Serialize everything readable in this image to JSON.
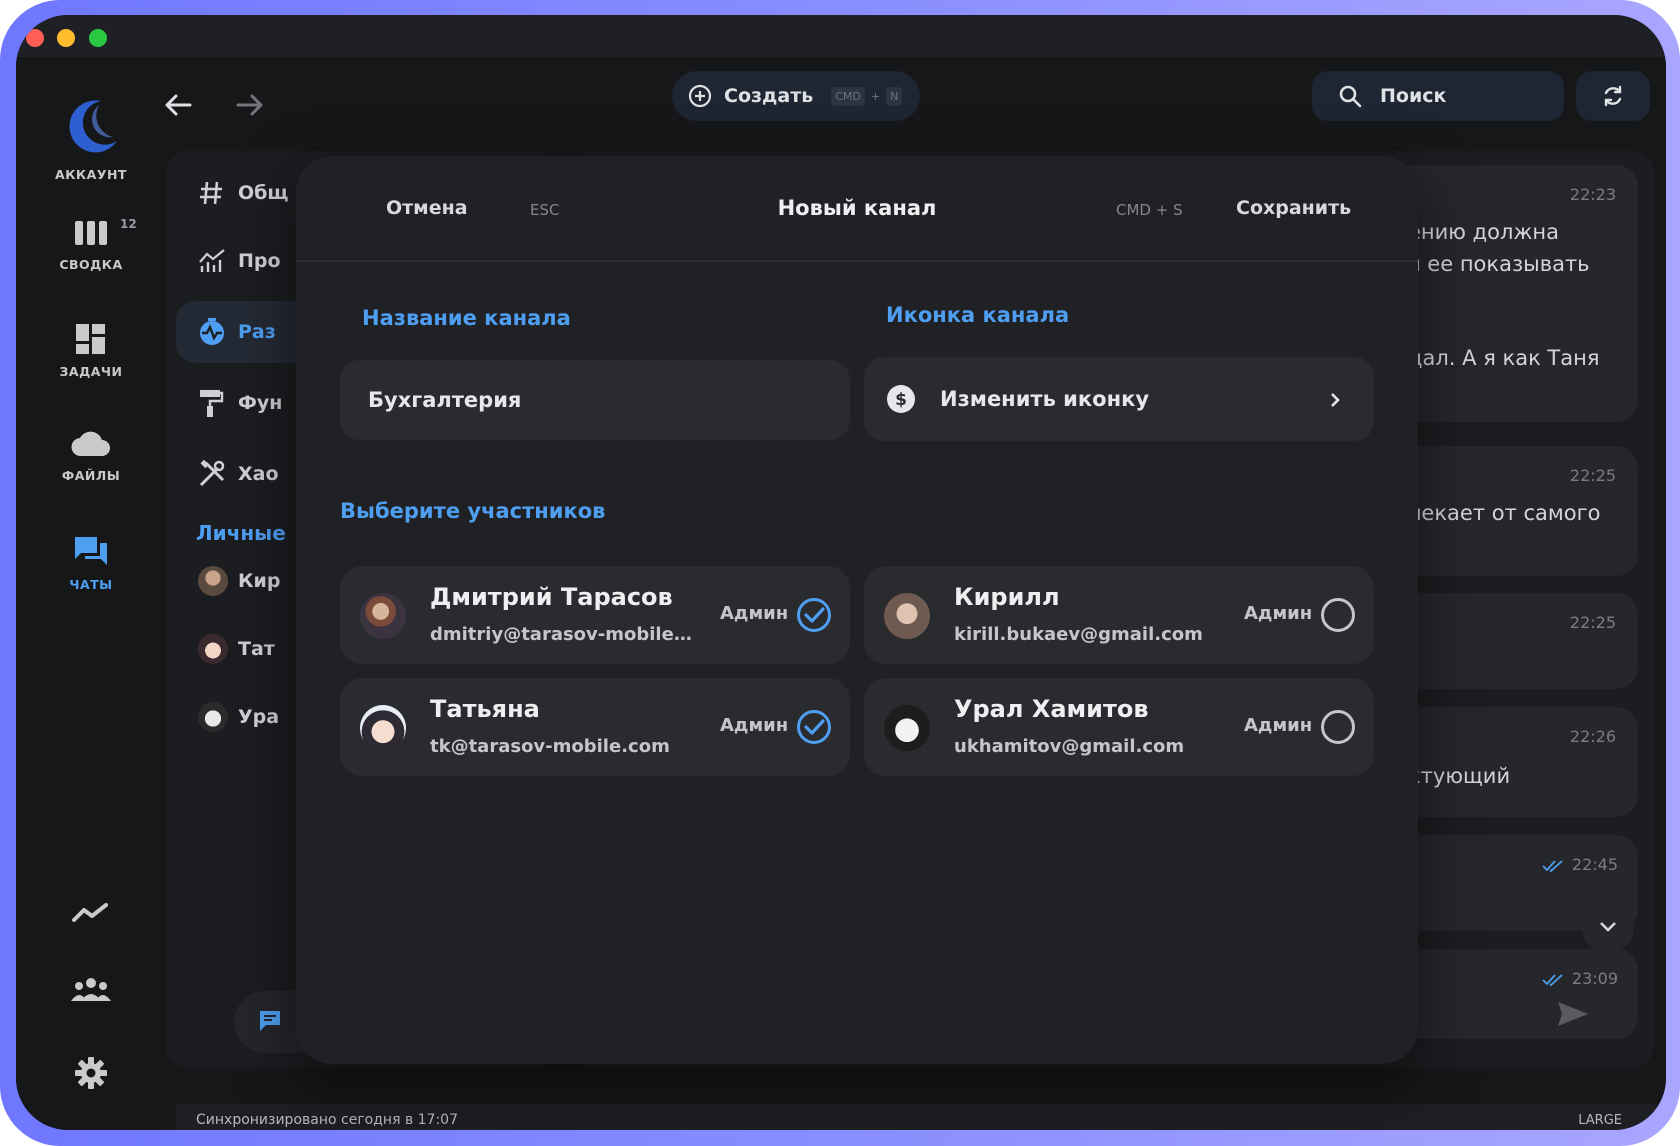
{
  "window": {
    "traffic_lights": [
      "close",
      "minimize",
      "zoom"
    ]
  },
  "rail": {
    "items": [
      {
        "label": "АККАУНТ",
        "icon": "crescent-logo-icon"
      },
      {
        "label": "СВОДКА",
        "icon": "columns-icon",
        "badge": "12"
      },
      {
        "label": "ЗАДАЧИ",
        "icon": "dashboard-icon"
      },
      {
        "label": "ФАЙЛЫ",
        "icon": "cloud-icon"
      },
      {
        "label": "ЧАТЫ",
        "icon": "chat-icon",
        "active": true
      }
    ],
    "bottom_icons": [
      "trend-icon",
      "team-icon",
      "settings-icon"
    ]
  },
  "toolbar": {
    "create_label": "Создать",
    "create_kbd_mod": "CMD",
    "create_kbd_plus": "+",
    "create_kbd_key": "N",
    "search_label": "Поиск"
  },
  "channels": {
    "items": [
      "Общ",
      "Про",
      "Раз",
      "Фун",
      "Хао"
    ],
    "personal_label": "Личные",
    "personal": [
      "Кир",
      "Тат",
      "Ура"
    ]
  },
  "chat": {
    "messages": [
      {
        "time": "22:23",
        "lines": [
          "ению должна",
          "я ее показывать",
          "",
          "дал. А я как Таня"
        ]
      },
      {
        "time": "22:25",
        "lines": [
          "лекает от самого"
        ]
      },
      {
        "time": "22:25",
        "lines": [
          ""
        ]
      },
      {
        "time": "22:26",
        "lines": [
          "ктующий"
        ]
      },
      {
        "time": "22:45",
        "lines": [
          ""
        ]
      },
      {
        "time": "23:09",
        "lines": [
          ""
        ]
      }
    ]
  },
  "status": {
    "sync_text": "Синхронизировано сегодня в 17:07",
    "size_label": "LARGE"
  },
  "modal": {
    "cancel_label": "Отмена",
    "cancel_kbd": "ESC",
    "title": "Новый канал",
    "save_kbd": "CMD + S",
    "save_label": "Сохранить",
    "name_section": "Название канала",
    "name_value": "Бухгалтерия",
    "icon_section": "Иконка канала",
    "icon_button": "Изменить иконку",
    "members_section": "Выберите участников",
    "members": [
      {
        "name": "Дмитрий Тарасов",
        "email": "dmitriy@tarasov-mobile.co…",
        "role": "Админ",
        "checked": true
      },
      {
        "name": "Кирилл",
        "email": "kirill.bukaev@gmail.com",
        "role": "Админ",
        "checked": false
      },
      {
        "name": "Татьяна",
        "email": "tk@tarasov-mobile.com",
        "role": "Админ",
        "checked": true
      },
      {
        "name": "Урал Хамитов",
        "email": "ukhamitov@gmail.com",
        "role": "Админ",
        "checked": false
      }
    ]
  },
  "colors": {
    "accent": "#4e9ef2",
    "bg": "#161719",
    "modal": "#202124",
    "card": "#2a2b2f",
    "frame": "#7b80ff"
  }
}
